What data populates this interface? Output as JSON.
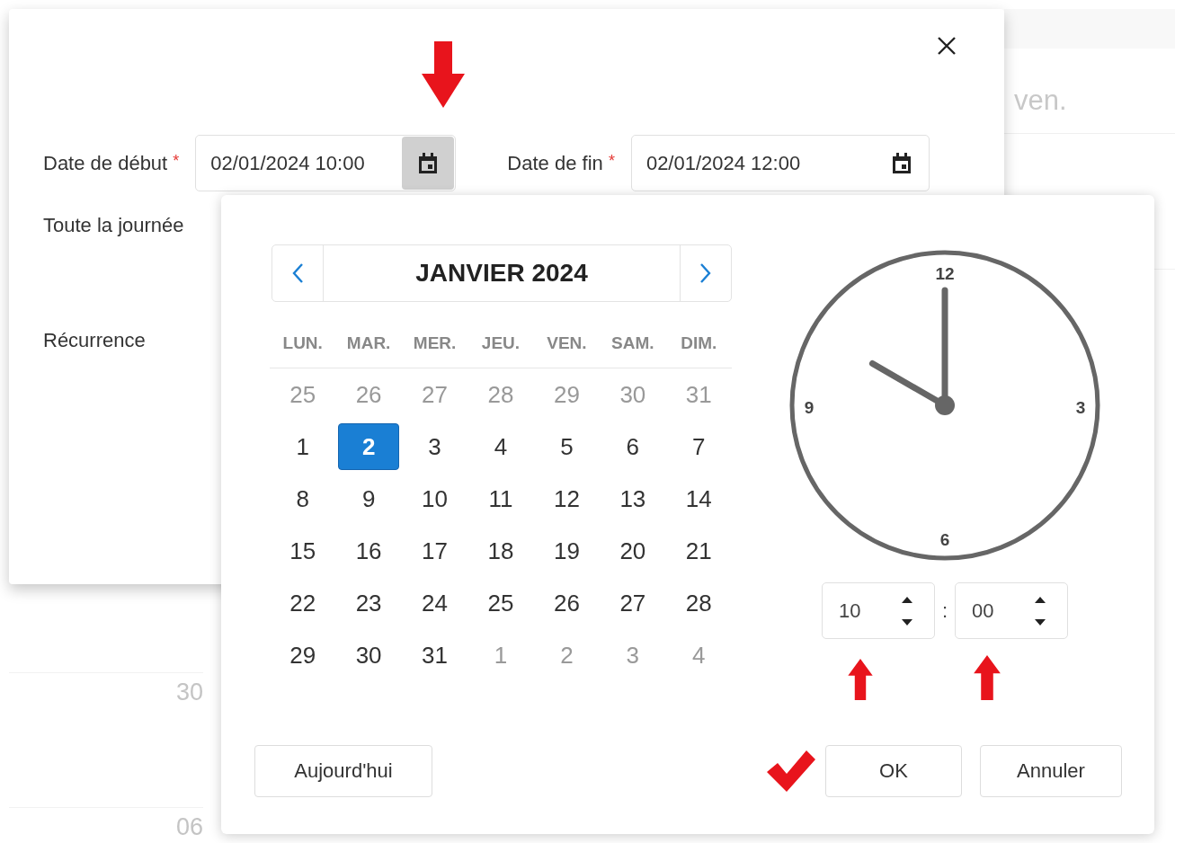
{
  "background": {
    "weekday": "ven.",
    "row_labels": [
      "30",
      "06"
    ]
  },
  "dialog": {
    "fields": [
      {
        "label": "Date de début",
        "required_mark": "*",
        "value": "02/01/2024 10:00",
        "picker_open": true
      },
      {
        "label": "Date de fin",
        "required_mark": "*",
        "value": "02/01/2024 12:00",
        "picker_open": false
      }
    ],
    "options": [
      "Toute la journée",
      "Récurrence"
    ]
  },
  "picker": {
    "month": "JANVIER 2024",
    "weekdays": [
      "LUN.",
      "MAR.",
      "MER.",
      "JEU.",
      "VEN.",
      "SAM.",
      "DIM."
    ],
    "weeks": [
      [
        {
          "day": "25",
          "outside": true,
          "selected": false
        },
        {
          "day": "26",
          "outside": true,
          "selected": false
        },
        {
          "day": "27",
          "outside": true,
          "selected": false
        },
        {
          "day": "28",
          "outside": true,
          "selected": false
        },
        {
          "day": "29",
          "outside": true,
          "selected": false
        },
        {
          "day": "30",
          "outside": true,
          "selected": false
        },
        {
          "day": "31",
          "outside": true,
          "selected": false
        }
      ],
      [
        {
          "day": "1",
          "outside": false,
          "selected": false
        },
        {
          "day": "2",
          "outside": false,
          "selected": true
        },
        {
          "day": "3",
          "outside": false,
          "selected": false
        },
        {
          "day": "4",
          "outside": false,
          "selected": false
        },
        {
          "day": "5",
          "outside": false,
          "selected": false
        },
        {
          "day": "6",
          "outside": false,
          "selected": false
        },
        {
          "day": "7",
          "outside": false,
          "selected": false
        }
      ],
      [
        {
          "day": "8",
          "outside": false,
          "selected": false
        },
        {
          "day": "9",
          "outside": false,
          "selected": false
        },
        {
          "day": "10",
          "outside": false,
          "selected": false
        },
        {
          "day": "11",
          "outside": false,
          "selected": false
        },
        {
          "day": "12",
          "outside": false,
          "selected": false
        },
        {
          "day": "13",
          "outside": false,
          "selected": false
        },
        {
          "day": "14",
          "outside": false,
          "selected": false
        }
      ],
      [
        {
          "day": "15",
          "outside": false,
          "selected": false
        },
        {
          "day": "16",
          "outside": false,
          "selected": false
        },
        {
          "day": "17",
          "outside": false,
          "selected": false
        },
        {
          "day": "18",
          "outside": false,
          "selected": false
        },
        {
          "day": "19",
          "outside": false,
          "selected": false
        },
        {
          "day": "20",
          "outside": false,
          "selected": false
        },
        {
          "day": "21",
          "outside": false,
          "selected": false
        }
      ],
      [
        {
          "day": "22",
          "outside": false,
          "selected": false
        },
        {
          "day": "23",
          "outside": false,
          "selected": false
        },
        {
          "day": "24",
          "outside": false,
          "selected": false
        },
        {
          "day": "25",
          "outside": false,
          "selected": false
        },
        {
          "day": "26",
          "outside": false,
          "selected": false
        },
        {
          "day": "27",
          "outside": false,
          "selected": false
        },
        {
          "day": "28",
          "outside": false,
          "selected": false
        }
      ],
      [
        {
          "day": "29",
          "outside": false,
          "selected": false
        },
        {
          "day": "30",
          "outside": false,
          "selected": false
        },
        {
          "day": "31",
          "outside": false,
          "selected": false
        },
        {
          "day": "1",
          "outside": true,
          "selected": false
        },
        {
          "day": "2",
          "outside": true,
          "selected": false
        },
        {
          "day": "3",
          "outside": true,
          "selected": false
        },
        {
          "day": "4",
          "outside": true,
          "selected": false
        }
      ]
    ],
    "clock_numbers": [
      "12",
      "3",
      "6",
      "9"
    ],
    "time": {
      "hour": "10",
      "separator": ":",
      "minute": "00"
    },
    "buttons": [
      "Aujourd'hui",
      "OK",
      "Annuler"
    ]
  }
}
